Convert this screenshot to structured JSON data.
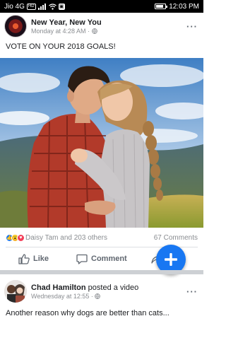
{
  "status_bar": {
    "carrier": "Jio 4G",
    "hd_badge": "HD",
    "time": "12:03 PM",
    "battery_level": 0.8
  },
  "post1": {
    "author": "New Year, New You",
    "timestamp": "Monday at 4:28 AM",
    "privacy_icon": "globe-icon",
    "text": "VOTE ON YOUR 2018 GOALS!",
    "reactions_text": "Daisy Tam and 203 others",
    "reaction_icons": [
      "like-icon",
      "wow-icon",
      "love-icon"
    ],
    "comments_count": "67 Comments",
    "actions": {
      "like": "Like",
      "comment": "Comment"
    }
  },
  "post2": {
    "author": "Chad Hamilton",
    "action_text": " posted a video",
    "timestamp": "Wednesday at 12:55",
    "privacy_icon": "globe-icon",
    "text": "Another reason why dogs are better than cats..."
  },
  "colors": {
    "brand_blue": "#1877f2",
    "text_primary": "#1c1e21",
    "text_secondary": "#8a8d91"
  }
}
